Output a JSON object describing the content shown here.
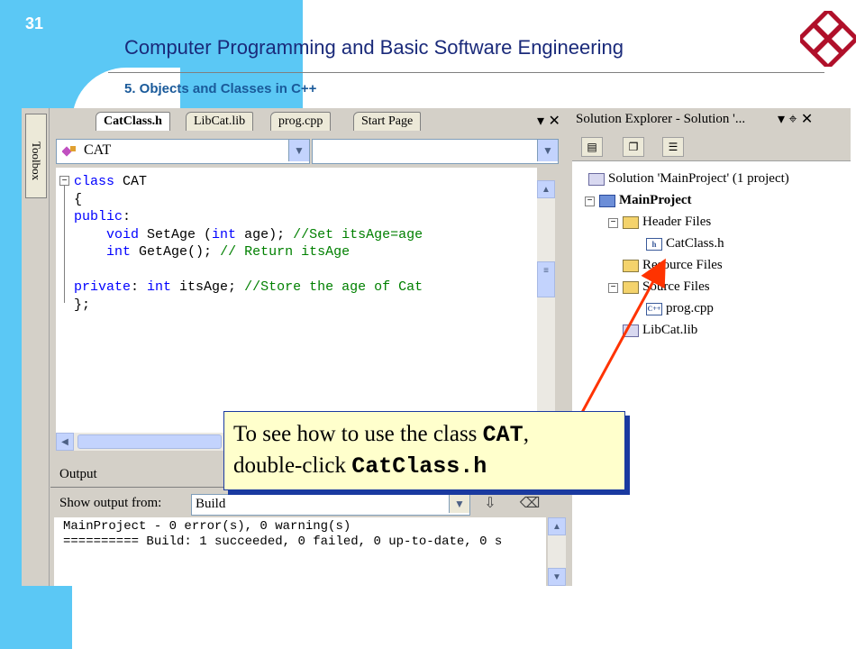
{
  "slide": {
    "number": "31",
    "title": "Computer Programming and Basic Software Engineering",
    "subtitle": "5. Objects and Classes in C++"
  },
  "toolbox": {
    "label": "Toolbox"
  },
  "editor": {
    "tabs": [
      "CatClass.h",
      "LibCat.lib",
      "prog.cpp",
      "Start Page"
    ],
    "active_tab": "CatClass.h",
    "tab_controls": "▾ ✕",
    "class_combo": "CAT",
    "member_combo": "",
    "code": {
      "l1_kw": "class",
      "l1_rest": " CAT",
      "l2": "{",
      "l3_kw": "public",
      "l3_rest": ":",
      "l4_kw": "void",
      "l4_rest": " SetAge (",
      "l4_kw2": "int",
      "l4_rest2": " age); ",
      "l4_cm": "//Set itsAge=age",
      "l5_kw": "int",
      "l5_rest": " GetAge(); ",
      "l5_cm": "// Return itsAge",
      "l7_kw": "private",
      "l7_rest": ": ",
      "l7_kw2": "int",
      "l7_rest2": " itsAge; ",
      "l7_cm": "//Store the age of Cat",
      "l8": "};"
    }
  },
  "output": {
    "title": "Output",
    "show_from_label": "Show output from:",
    "show_from_value": "Build",
    "lines": [
      "MainProject - 0 error(s), 0 warning(s)",
      "========== Build: 1 succeeded, 0 failed, 0 up-to-date, 0 s"
    ]
  },
  "solution_explorer": {
    "title": "Solution Explorer - Solution '...",
    "controls": "▾ ⌖ ✕",
    "tree": {
      "solution": "Solution 'MainProject' (1 project)",
      "project": "MainProject",
      "header_files": "Header Files",
      "catclass_h": "CatClass.h",
      "resource_files": "Resource Files",
      "source_files": "Source Files",
      "prog_cpp": "prog.cpp",
      "libcat_lib": "LibCat.lib"
    }
  },
  "callout": {
    "line1_pre": "To see how to use the class ",
    "line1_code": "CAT",
    "line1_post": ",",
    "line2_pre": "double-click ",
    "line2_code": "CatClass.h"
  },
  "colors": {
    "slide_accent": "#5bc8f5",
    "title_color": "#1a2a7a",
    "arrow": "#ff3300",
    "callout_bg": "#ffffcc"
  }
}
